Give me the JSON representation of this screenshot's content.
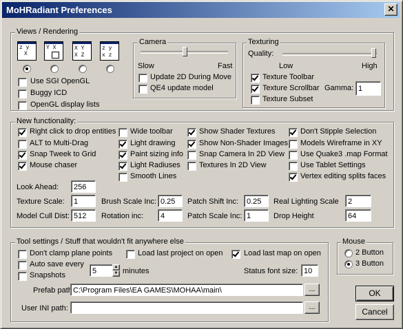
{
  "window": {
    "title": "MoHRadiant Preferences",
    "close_label": "✕"
  },
  "views": {
    "group_label": "Views / Rendering",
    "layout_icons": [
      "view-layout-1-icon",
      "view-layout-2-icon",
      "view-layout-3-icon",
      "view-layout-4-icon"
    ],
    "selected_layout": 0,
    "use_sgi": "Use SGI OpenGL",
    "buggy_icd": "Buggy ICD",
    "display_lists": "OpenGL display lists"
  },
  "camera": {
    "group_label": "Camera",
    "slow": "Slow",
    "fast": "Fast",
    "speed_fraction": 0.64,
    "update_2d": "Update 2D During Move",
    "update_2d_checked": false,
    "qe4": "QE4 update model",
    "qe4_checked": false
  },
  "texturing": {
    "group_label": "Texturing",
    "quality": "Quality:",
    "low": "Low",
    "high": "High",
    "quality_fraction": 0.98,
    "toolbar": "Texture Toolbar",
    "scrollbar": "Texture Scrollbar",
    "subset": "Texture Subset",
    "gamma_label": "Gamma:",
    "gamma_value": "1"
  },
  "functionality": {
    "group_label": "New functionality:",
    "col1": [
      {
        "label": "Right click to drop entities",
        "checked": true
      },
      {
        "label": "ALT to Multi-Drag",
        "checked": false
      },
      {
        "label": "Snap Tweek to Grid",
        "checked": true
      },
      {
        "label": "Mouse chaser",
        "checked": true
      }
    ],
    "col2": [
      {
        "label": "Wide toolbar",
        "checked": false
      },
      {
        "label": "Light drawing",
        "checked": true
      },
      {
        "label": "Paint sizing info",
        "checked": true
      },
      {
        "label": "Light Radiuses",
        "checked": true
      },
      {
        "label": "Smooth Lines",
        "checked": false
      }
    ],
    "col3": [
      {
        "label": "Show Shader Textures",
        "checked": true
      },
      {
        "label": "Show Non-Shader Images",
        "checked": true
      },
      {
        "label": "Snap Camera In 2D View",
        "checked": false
      },
      {
        "label": "Textures In 2D View",
        "checked": false
      }
    ],
    "col4": [
      {
        "label": "Don't Stipple Selection",
        "checked": true
      },
      {
        "label": "Models Wireframe in XY",
        "checked": false
      },
      {
        "label": "Use Quake3 .map Format",
        "checked": false
      },
      {
        "label": "Use Tablet Settings",
        "checked": false
      },
      {
        "label": "Vertex editing splits faces",
        "checked": true
      }
    ],
    "look_ahead_label": "Look Ahead:",
    "look_ahead_value": "256",
    "texture_scale_label": "Texture Scale:",
    "texture_scale_value": "1",
    "model_cull_label": "Model Cull Dist:",
    "model_cull_value": "512",
    "brush_scale_label": "Brush Scale Inc:",
    "brush_scale_value": "0.25",
    "rotation_label": "Rotation inc:",
    "rotation_value": "4",
    "patch_shift_label": "Patch Shift Inc:",
    "patch_shift_value": "0.25",
    "patch_scale_label": "Patch Scale Inc:",
    "patch_scale_value": "1",
    "real_light_label": "Real Lighting Scale",
    "real_light_value": "2",
    "drop_height_label": "Drop Height",
    "drop_height_value": "64"
  },
  "tools": {
    "group_label": "Tool settings / Stuff that wouldn't fit anywhere else",
    "dont_clamp": "Don't clamp plane points",
    "load_project": "Load last project on open",
    "load_map": "Load last map on open",
    "auto_save": "Auto save every",
    "auto_save_value": "5",
    "minutes": "minutes",
    "snapshots": "Snapshots",
    "status_font_label": "Status font size:",
    "status_font_value": "10",
    "prefab_label": "Prefab path:",
    "prefab_value": "C:\\Program Files\\EA GAMES\\MOHAA\\main\\",
    "ini_label": "User INI path:",
    "ini_value": "",
    "browse": "..."
  },
  "mouse": {
    "group_label": "Mouse",
    "two": "2 Button",
    "three": "3 Button"
  },
  "buttons": {
    "ok": "OK",
    "cancel": "Cancel"
  },
  "colors": {
    "titlebar_start": "#0a246a",
    "titlebar_end": "#a6caf0",
    "face": "#d4d0c8"
  }
}
